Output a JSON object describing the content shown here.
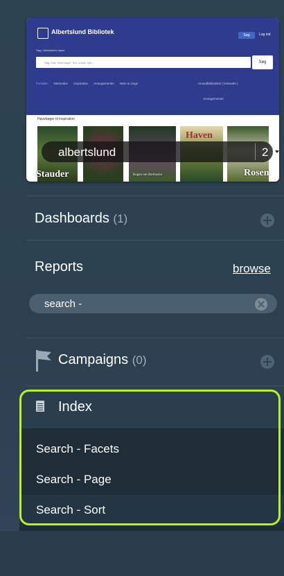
{
  "thumbnail": {
    "site_title": "Albertslund Bibliotek",
    "search_button": "Søg",
    "login": "Log ind",
    "search_label": "Søg i bibliotekets baser",
    "search_placeholder": "Søg f.eks. efter bøger, film, musik, spil...",
    "search_submit": "Søg",
    "nav_items": [
      "Forsiden",
      "Netmedier",
      "Inspiration",
      "Arrangementer",
      "Børn & Unge"
    ],
    "nav_right": "Hovedbiblioteket | Kalender |",
    "nav_sub": "Arrangementer",
    "section_heading": "Havebøger til inspiration",
    "image_labels": [
      "Stauder",
      "Bogen om Bærbuske",
      "Haven",
      "Rosen"
    ],
    "overlay_text": "albertslund",
    "overlay_count": "2"
  },
  "dashboards": {
    "label": "Dashboards",
    "count": "(1)"
  },
  "reports": {
    "label": "Reports",
    "browse": "browse",
    "filter_value": "search -"
  },
  "campaigns": {
    "label": "Campaigns",
    "count": "(0)"
  },
  "index": {
    "label": "Index",
    "items": [
      "Search - Facets",
      "Search - Page",
      "Search - Sort"
    ]
  },
  "colors": {
    "highlight_outline": "#b6f520",
    "panel_bg": "#2e4352"
  },
  "icons": [
    "plus-icon",
    "clear-icon",
    "flag-icon",
    "document-icon",
    "dropdown-arrow-icon",
    "library-logo-icon"
  ]
}
